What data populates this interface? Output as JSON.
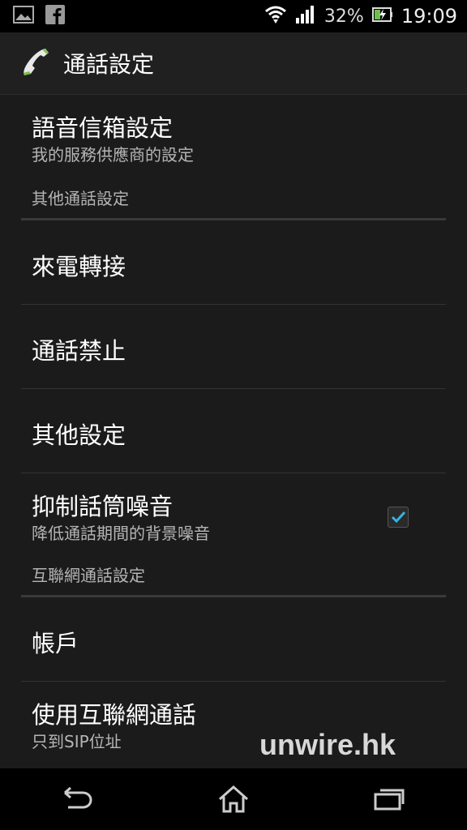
{
  "status_bar": {
    "battery": "32%",
    "time": "19:09",
    "icons": [
      "gallery-icon",
      "facebook-icon",
      "wifi-icon",
      "signal-icon",
      "battery-icon"
    ]
  },
  "action_bar": {
    "title": "通話設定",
    "icon": "phone-handset-icon"
  },
  "list": {
    "voicemail": {
      "title": "語音信箱設定",
      "summary": "我的服務供應商的設定"
    },
    "category_other": "其他通話設定",
    "call_forwarding": {
      "title": "來電轉接"
    },
    "call_barring": {
      "title": "通話禁止"
    },
    "other_settings": {
      "title": "其他設定"
    },
    "noise_suppression": {
      "title": "抑制話筒噪音",
      "summary": "降低通話期間的背景噪音",
      "checked": true
    },
    "category_internet": "互聯網通話設定",
    "accounts": {
      "title": "帳戶"
    },
    "use_internet_calling": {
      "title": "使用互聯網通話",
      "summary": "只到SIP位址"
    }
  },
  "watermark": "unwire.hk",
  "nav_bar": {
    "icons": [
      "back-icon",
      "home-icon",
      "recent-apps-icon"
    ]
  },
  "colors": {
    "accent": "#33b5e5",
    "background": "#1b1b1b",
    "statusbar": "#000000"
  }
}
